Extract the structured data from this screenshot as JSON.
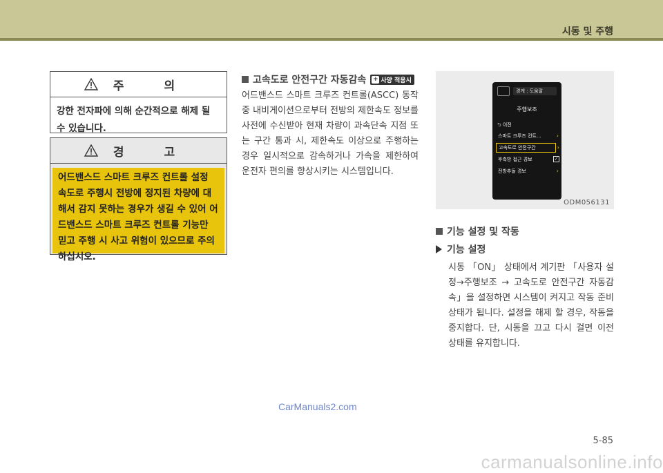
{
  "header": {
    "section_title": "시동 및 주행"
  },
  "caution": {
    "title": "주 의",
    "text": "강한 전자파에 의해 순간적으로 해제 될 수 있습니다."
  },
  "warning": {
    "title": "경 고",
    "text": "어드밴스드 스마트 크루즈 컨트롤 설정 속도로 주행시 전방에 정지된 차량에 대해서 감지 못하는 경우가 생길 수 있어 어드밴스드 스마트 크루즈 컨트롤 기능만 믿고 주행 시 사고 위험이 있으므로 주의 하십시오."
  },
  "middle": {
    "heading": "고속도로 안전구간 자동감속",
    "badge": "사양 적용시",
    "paragraph": "어드밴스드 스마트 크루즈 컨트롤(ASCC) 동작 중 내비게이션으로부터 전방의 제한속도 정보를 사전에 수신받아 현재 차량이 과속단속 지점 또는 구간 통과 시, 제한속도 이상으로 주행하는 경우 일시적으로 감속하거나 가속을 제한하여 운전자 편의를 향상시키는 시스템입니다."
  },
  "figure": {
    "screen_nav": "경계 : 도움말",
    "screen_title": "주행보조",
    "back": "⮌ 이전",
    "items": [
      "스마트 크루즈 컨트...",
      "고속도로 안전구간",
      "후측방 접근 경보",
      "전방추돌 경보"
    ],
    "code": "ODM056131"
  },
  "right": {
    "heading": "기능 설정 및 작동",
    "subheading": "기능 설정",
    "paragraph": "시동 「ON」 상태에서 계기판 「사용자 설정→주행보조 → 고속도로 안전구간 자동감속」을 설정하면 시스템이 켜지고 작동 준비상태가 됩니다. 설정을 해제 할 경우, 작동을 중지합다. 단, 시동을 끄고 다시 걸면 이전 상태를 유지합니다."
  },
  "footer": {
    "watermark_top": "CarManuals2.com",
    "page_number": "5-85",
    "watermark_bottom": "carmanualsonline.info"
  }
}
